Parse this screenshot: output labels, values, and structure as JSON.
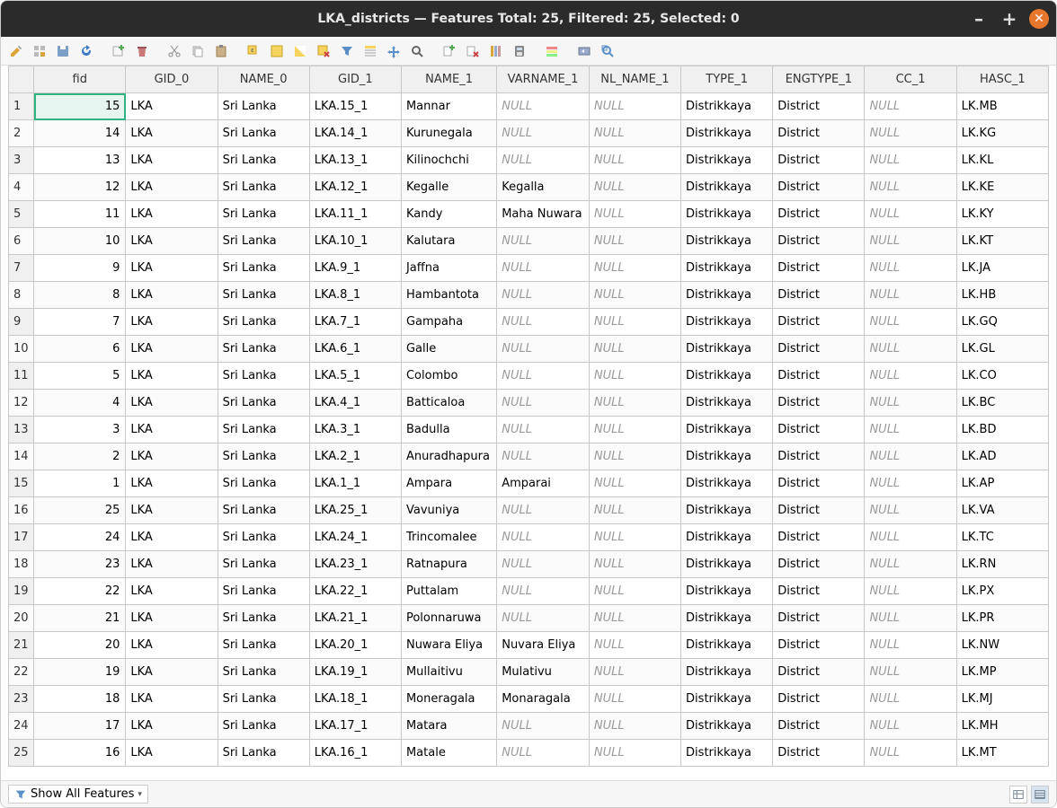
{
  "window": {
    "title": "LKA_districts — Features Total: 25, Filtered: 25, Selected: 0"
  },
  "columns": [
    "fid",
    "GID_0",
    "NAME_0",
    "GID_1",
    "NAME_1",
    "VARNAME_1",
    "NL_NAME_1",
    "TYPE_1",
    "ENGTYPE_1",
    "CC_1",
    "HASC_1"
  ],
  "rows": [
    {
      "n": "1",
      "fid": "15",
      "gid0": "LKA",
      "name0": "Sri Lanka",
      "gid1": "LKA.15_1",
      "name1": "Mannar",
      "var": null,
      "nl": null,
      "type": "Distrikkaya",
      "eng": "District",
      "cc": null,
      "hasc": "LK.MB"
    },
    {
      "n": "2",
      "fid": "14",
      "gid0": "LKA",
      "name0": "Sri Lanka",
      "gid1": "LKA.14_1",
      "name1": "Kurunegala",
      "var": null,
      "nl": null,
      "type": "Distrikkaya",
      "eng": "District",
      "cc": null,
      "hasc": "LK.KG"
    },
    {
      "n": "3",
      "fid": "13",
      "gid0": "LKA",
      "name0": "Sri Lanka",
      "gid1": "LKA.13_1",
      "name1": "Kilinochchi",
      "var": null,
      "nl": null,
      "type": "Distrikkaya",
      "eng": "District",
      "cc": null,
      "hasc": "LK.KL"
    },
    {
      "n": "4",
      "fid": "12",
      "gid0": "LKA",
      "name0": "Sri Lanka",
      "gid1": "LKA.12_1",
      "name1": "Kegalle",
      "var": "Kegalla",
      "nl": null,
      "type": "Distrikkaya",
      "eng": "District",
      "cc": null,
      "hasc": "LK.KE"
    },
    {
      "n": "5",
      "fid": "11",
      "gid0": "LKA",
      "name0": "Sri Lanka",
      "gid1": "LKA.11_1",
      "name1": "Kandy",
      "var": "Maha Nuwara",
      "nl": null,
      "type": "Distrikkaya",
      "eng": "District",
      "cc": null,
      "hasc": "LK.KY"
    },
    {
      "n": "6",
      "fid": "10",
      "gid0": "LKA",
      "name0": "Sri Lanka",
      "gid1": "LKA.10_1",
      "name1": "Kalutara",
      "var": null,
      "nl": null,
      "type": "Distrikkaya",
      "eng": "District",
      "cc": null,
      "hasc": "LK.KT"
    },
    {
      "n": "7",
      "fid": "9",
      "gid0": "LKA",
      "name0": "Sri Lanka",
      "gid1": "LKA.9_1",
      "name1": "Jaffna",
      "var": null,
      "nl": null,
      "type": "Distrikkaya",
      "eng": "District",
      "cc": null,
      "hasc": "LK.JA"
    },
    {
      "n": "8",
      "fid": "8",
      "gid0": "LKA",
      "name0": "Sri Lanka",
      "gid1": "LKA.8_1",
      "name1": "Hambantota",
      "var": null,
      "nl": null,
      "type": "Distrikkaya",
      "eng": "District",
      "cc": null,
      "hasc": "LK.HB"
    },
    {
      "n": "9",
      "fid": "7",
      "gid0": "LKA",
      "name0": "Sri Lanka",
      "gid1": "LKA.7_1",
      "name1": "Gampaha",
      "var": null,
      "nl": null,
      "type": "Distrikkaya",
      "eng": "District",
      "cc": null,
      "hasc": "LK.GQ"
    },
    {
      "n": "10",
      "fid": "6",
      "gid0": "LKA",
      "name0": "Sri Lanka",
      "gid1": "LKA.6_1",
      "name1": "Galle",
      "var": null,
      "nl": null,
      "type": "Distrikkaya",
      "eng": "District",
      "cc": null,
      "hasc": "LK.GL"
    },
    {
      "n": "11",
      "fid": "5",
      "gid0": "LKA",
      "name0": "Sri Lanka",
      "gid1": "LKA.5_1",
      "name1": "Colombo",
      "var": null,
      "nl": null,
      "type": "Distrikkaya",
      "eng": "District",
      "cc": null,
      "hasc": "LK.CO"
    },
    {
      "n": "12",
      "fid": "4",
      "gid0": "LKA",
      "name0": "Sri Lanka",
      "gid1": "LKA.4_1",
      "name1": "Batticaloa",
      "var": null,
      "nl": null,
      "type": "Distrikkaya",
      "eng": "District",
      "cc": null,
      "hasc": "LK.BC"
    },
    {
      "n": "13",
      "fid": "3",
      "gid0": "LKA",
      "name0": "Sri Lanka",
      "gid1": "LKA.3_1",
      "name1": "Badulla",
      "var": null,
      "nl": null,
      "type": "Distrikkaya",
      "eng": "District",
      "cc": null,
      "hasc": "LK.BD"
    },
    {
      "n": "14",
      "fid": "2",
      "gid0": "LKA",
      "name0": "Sri Lanka",
      "gid1": "LKA.2_1",
      "name1": "Anuradhapura",
      "var": null,
      "nl": null,
      "type": "Distrikkaya",
      "eng": "District",
      "cc": null,
      "hasc": "LK.AD"
    },
    {
      "n": "15",
      "fid": "1",
      "gid0": "LKA",
      "name0": "Sri Lanka",
      "gid1": "LKA.1_1",
      "name1": "Ampara",
      "var": "Amparai",
      "nl": null,
      "type": "Distrikkaya",
      "eng": "District",
      "cc": null,
      "hasc": "LK.AP"
    },
    {
      "n": "16",
      "fid": "25",
      "gid0": "LKA",
      "name0": "Sri Lanka",
      "gid1": "LKA.25_1",
      "name1": "Vavuniya",
      "var": null,
      "nl": null,
      "type": "Distrikkaya",
      "eng": "District",
      "cc": null,
      "hasc": "LK.VA"
    },
    {
      "n": "17",
      "fid": "24",
      "gid0": "LKA",
      "name0": "Sri Lanka",
      "gid1": "LKA.24_1",
      "name1": "Trincomalee",
      "var": null,
      "nl": null,
      "type": "Distrikkaya",
      "eng": "District",
      "cc": null,
      "hasc": "LK.TC"
    },
    {
      "n": "18",
      "fid": "23",
      "gid0": "LKA",
      "name0": "Sri Lanka",
      "gid1": "LKA.23_1",
      "name1": "Ratnapura",
      "var": null,
      "nl": null,
      "type": "Distrikkaya",
      "eng": "District",
      "cc": null,
      "hasc": "LK.RN"
    },
    {
      "n": "19",
      "fid": "22",
      "gid0": "LKA",
      "name0": "Sri Lanka",
      "gid1": "LKA.22_1",
      "name1": "Puttalam",
      "var": null,
      "nl": null,
      "type": "Distrikkaya",
      "eng": "District",
      "cc": null,
      "hasc": "LK.PX"
    },
    {
      "n": "20",
      "fid": "21",
      "gid0": "LKA",
      "name0": "Sri Lanka",
      "gid1": "LKA.21_1",
      "name1": "Polonnaruwa",
      "var": null,
      "nl": null,
      "type": "Distrikkaya",
      "eng": "District",
      "cc": null,
      "hasc": "LK.PR"
    },
    {
      "n": "21",
      "fid": "20",
      "gid0": "LKA",
      "name0": "Sri Lanka",
      "gid1": "LKA.20_1",
      "name1": "Nuwara Eliya",
      "var": "Nuvara Eliya",
      "nl": null,
      "type": "Distrikkaya",
      "eng": "District",
      "cc": null,
      "hasc": "LK.NW"
    },
    {
      "n": "22",
      "fid": "19",
      "gid0": "LKA",
      "name0": "Sri Lanka",
      "gid1": "LKA.19_1",
      "name1": "Mullaitivu",
      "var": "Mulativu",
      "nl": null,
      "type": "Distrikkaya",
      "eng": "District",
      "cc": null,
      "hasc": "LK.MP"
    },
    {
      "n": "23",
      "fid": "18",
      "gid0": "LKA",
      "name0": "Sri Lanka",
      "gid1": "LKA.18_1",
      "name1": "Moneragala",
      "var": "Monaragala",
      "nl": null,
      "type": "Distrikkaya",
      "eng": "District",
      "cc": null,
      "hasc": "LK.MJ"
    },
    {
      "n": "24",
      "fid": "17",
      "gid0": "LKA",
      "name0": "Sri Lanka",
      "gid1": "LKA.17_1",
      "name1": "Matara",
      "var": null,
      "nl": null,
      "type": "Distrikkaya",
      "eng": "District",
      "cc": null,
      "hasc": "LK.MH"
    },
    {
      "n": "25",
      "fid": "16",
      "gid0": "LKA",
      "name0": "Sri Lanka",
      "gid1": "LKA.16_1",
      "name1": "Matale",
      "var": null,
      "nl": null,
      "type": "Distrikkaya",
      "eng": "District",
      "cc": null,
      "hasc": "LK.MT"
    }
  ],
  "selected_cell": {
    "row": 0,
    "col": "fid"
  },
  "null_label": "NULL",
  "status": {
    "filter_label": "Show All Features"
  },
  "icons": {
    "pencil": "pencil-icon",
    "multiedit": "multiedit-icon",
    "save": "save-icon",
    "reload": "reload-icon",
    "addfeat": "add-feature-icon",
    "delfeat": "delete-feature-icon",
    "cut": "cut-icon",
    "copy": "copy-icon",
    "paste": "paste-icon",
    "selectexpr": "select-expression-icon",
    "selectall": "select-all-icon",
    "invert": "invert-selection-icon",
    "deselect": "deselect-icon",
    "filtersel": "filter-selection-icon",
    "movesel": "move-selection-top-icon",
    "pan": "pan-to-selected-icon",
    "zoom": "zoom-to-selected-icon",
    "newcol": "new-field-icon",
    "delcol": "delete-field-icon",
    "organize": "organize-columns-icon",
    "fieldcalc": "field-calc-icon",
    "cond": "conditional-format-icon",
    "actions": "actions-icon",
    "dock": "dock-icon"
  }
}
